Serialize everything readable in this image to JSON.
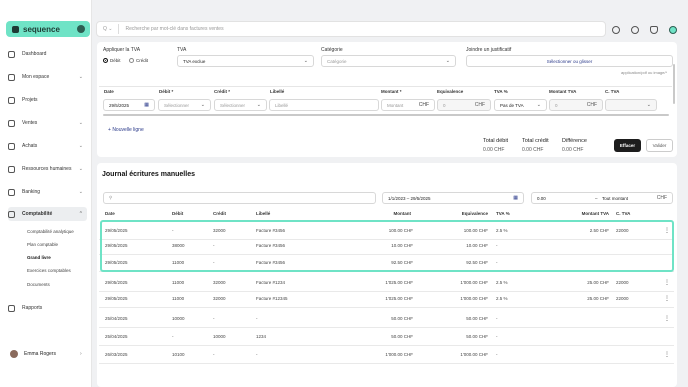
{
  "app": {
    "name": "sequence"
  },
  "sidebar": {
    "items": [
      {
        "label": "Dashboard",
        "chevron": ""
      },
      {
        "label": "Mon espace",
        "chevron": "⌄"
      },
      {
        "label": "Projets",
        "chevron": ""
      },
      {
        "label": "Ventes",
        "chevron": "⌄"
      },
      {
        "label": "Achats",
        "chevron": "⌄"
      },
      {
        "label": "Ressources humaines",
        "chevron": "⌄"
      },
      {
        "label": "Banking",
        "chevron": "⌄"
      },
      {
        "label": "Comptabilité",
        "chevron": "⌃"
      },
      {
        "label": "Rapports",
        "chevron": ""
      }
    ],
    "sub": [
      "Comptabilité analytique",
      "Plan comptable",
      "Grand livre",
      "Exercices comptables",
      "Documents"
    ],
    "user": "Emma Rogers"
  },
  "topbar": {
    "search_placeholder": "Recherche par mot-clé dans factures ventes",
    "search_icon_text": "Q ⌄"
  },
  "form": {
    "tva_label": "Appliquer la TVA",
    "debit_radio": "Débit",
    "credit_radio": "Crédit",
    "tva_col_label": "TVA",
    "tva_value": "TVA exclue",
    "categorie_label": "Catégorie",
    "categorie_placeholder": "Catégorie",
    "justif_label": "Joindre un justificatif",
    "justif_button": "Sélectionner ou glisser",
    "justif_hint": "application/pdf ou image/*",
    "headers": {
      "date": "Date",
      "debit": "Débit *",
      "credit": "Crédit *",
      "libelle": "Libellé",
      "montant": "Montant *",
      "equivalence": "Equivalence",
      "tva": "TVA %",
      "montant_tva": "Montant TVA",
      "c_tva": "C. TVA"
    },
    "row": {
      "date": "29/5/2025",
      "debit": "Sélectionner",
      "credit": "Sélectionner",
      "libelle": "Libellé",
      "montant": "Montant",
      "montant_cur": "CHF",
      "equivalence": "0",
      "equivalence_cur": "CHF",
      "tva": "Pas de TVA",
      "montant_tva": "0",
      "montant_tva_cur": "CHF"
    },
    "add_line": "Nouvelle ligne",
    "totals": {
      "debit_label": "Total débit",
      "debit_value": "0.00 CHF",
      "credit_label": "Total crédit",
      "credit_value": "0.00 CHF",
      "diff_label": "Différence",
      "diff_value": "0.00 CHF"
    },
    "clear_button": "Effacer",
    "validate_button": "Valider"
  },
  "journal": {
    "title": "Journal écritures manuelles",
    "date_range": "1/1/2023 – 29/5/2025",
    "amount_from": "0.00",
    "amount_sep": "–",
    "amount_to": "Tout montant",
    "amount_cur": "CHF",
    "headers": {
      "date": "Date",
      "debit": "Débit",
      "credit": "Crédit",
      "libelle": "Libellé",
      "montant": "Montant",
      "equivalence": "Equivalence",
      "tva": "TVA %",
      "montant_tva": "Montant TVA",
      "c_tva": "C. TVA"
    },
    "rows": [
      {
        "date": "29/05/2025",
        "debit": "-",
        "credit": "32000",
        "libelle": "Facture #3456",
        "montant": "100.00 CHF",
        "equivalence": "100.00 CHF",
        "tva": "2.5 %",
        "montant_tva": "2.50 CHF",
        "c_tva": "22000",
        "menu": "⋮"
      },
      {
        "date": "29/05/2025",
        "debit": "38000",
        "credit": "-",
        "libelle": "Facture #3456",
        "montant": "10.00 CHF",
        "equivalence": "10.00 CHF",
        "tva": "-",
        "montant_tva": "",
        "c_tva": "",
        "menu": ""
      },
      {
        "date": "29/05/2025",
        "debit": "11000",
        "credit": "-",
        "libelle": "Facture #3456",
        "montant": "92.50 CHF",
        "equivalence": "92.50 CHF",
        "tva": "-",
        "montant_tva": "",
        "c_tva": "",
        "menu": ""
      },
      {
        "date": "29/05/2025",
        "debit": "11000",
        "credit": "32000",
        "libelle": "Facture #1234",
        "montant": "1'025.00 CHF",
        "equivalence": "1'000.00 CHF",
        "tva": "2.5 %",
        "montant_tva": "25.00 CHF",
        "c_tva": "22000",
        "menu": "⋮"
      },
      {
        "date": "29/05/2025",
        "debit": "11000",
        "credit": "32000",
        "libelle": "Facture #12345",
        "montant": "1'025.00 CHF",
        "equivalence": "1'000.00 CHF",
        "tva": "2.5 %",
        "montant_tva": "25.00 CHF",
        "c_tva": "22000",
        "menu": "⋮"
      },
      {
        "date": "25/04/2025",
        "debit": "10000",
        "credit": "-",
        "libelle": "-",
        "montant": "50.00 CHF",
        "equivalence": "50.00 CHF",
        "tva": "-",
        "montant_tva": "",
        "c_tva": "",
        "menu": "⋮"
      },
      {
        "date": "25/04/2025",
        "debit": "-",
        "credit": "10000",
        "libelle": "1234",
        "montant": "50.00 CHF",
        "equivalence": "50.00 CHF",
        "tva": "-",
        "montant_tva": "",
        "c_tva": "",
        "menu": ""
      },
      {
        "date": "26/03/2025",
        "debit": "10100",
        "credit": "-",
        "libelle": "-",
        "montant": "1'000.00 CHF",
        "equivalence": "1'000.00 CHF",
        "tva": "-",
        "montant_tva": "",
        "c_tva": "",
        "menu": "⋮"
      }
    ]
  },
  "colors": {
    "accent": "#6fe3c6",
    "dark": "#1d1d1d"
  }
}
